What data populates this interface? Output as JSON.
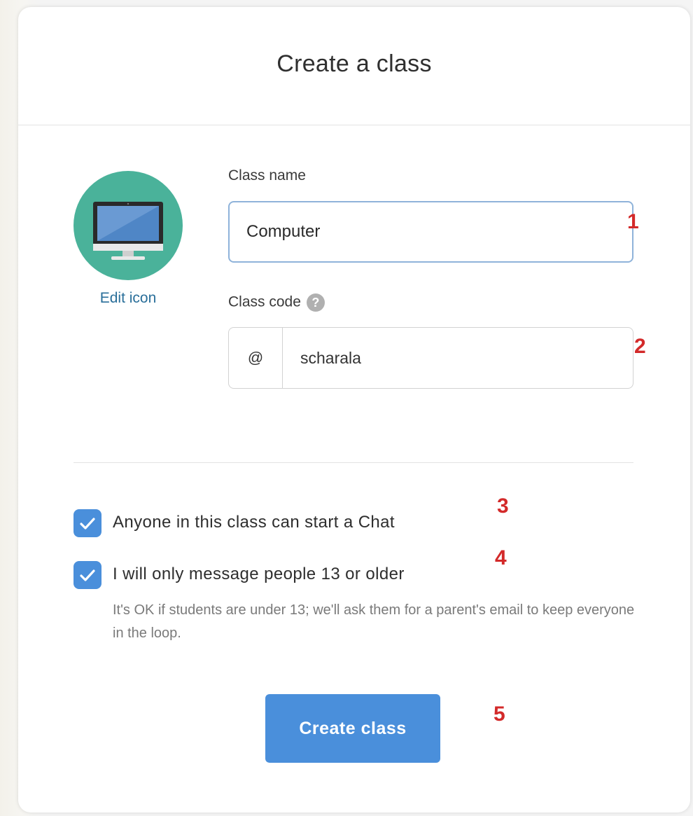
{
  "dialog": {
    "title": "Create a class"
  },
  "icon": {
    "name": "computer-monitor-icon",
    "background_color": "#4ab29a",
    "edit_label": "Edit icon"
  },
  "fields": {
    "class_name": {
      "label": "Class name",
      "value": "Computer"
    },
    "class_code": {
      "label": "Class code",
      "help_icon": "question-mark-icon",
      "help_glyph": "?",
      "prefix": "@",
      "value": "scharala"
    }
  },
  "options": [
    {
      "label": "Anyone in this class can start a Chat",
      "checked": true
    },
    {
      "label": "I will only message people 13 or older",
      "checked": true,
      "helper": "It's OK if students are under 13; we'll ask them for a parent's email to keep everyone in the loop."
    }
  ],
  "submit": {
    "label": "Create class"
  },
  "annotations": [
    "1",
    "2",
    "3",
    "4",
    "5"
  ],
  "colors": {
    "accent": "#4a8fdb",
    "annotation": "#d32a2a",
    "link": "#2a6f9a",
    "input_focus_border": "#8fb3da"
  }
}
